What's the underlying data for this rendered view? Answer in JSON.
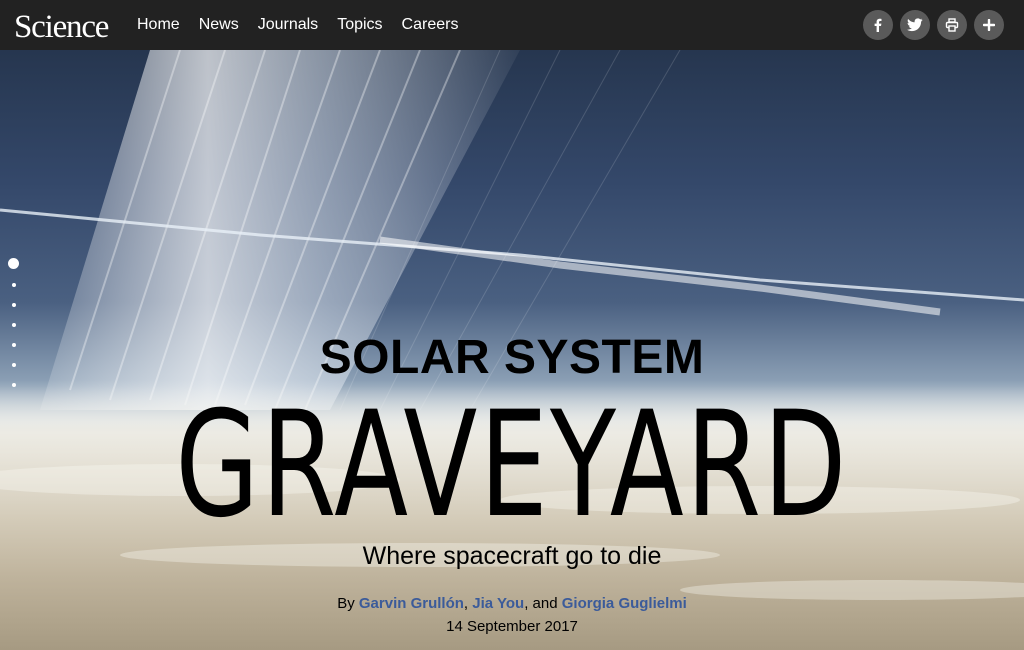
{
  "brand": {
    "logo_text": "Science"
  },
  "nav": {
    "items": [
      "Home",
      "News",
      "Journals",
      "Topics",
      "Careers"
    ]
  },
  "social": [
    {
      "name": "facebook-icon"
    },
    {
      "name": "twitter-icon"
    },
    {
      "name": "print-icon"
    },
    {
      "name": "plus-icon"
    }
  ],
  "article": {
    "kicker": "SOLAR SYSTEM",
    "title": "GRAVEYARD",
    "subtitle": "Where spacecraft go to die",
    "byline_prefix": "By",
    "authors": [
      "Garvin Grullón",
      "Jia You",
      "Giorgia Guglielmi"
    ],
    "author_sep_1": ",",
    "author_sep_2": ", and",
    "date": "14 September 2017"
  },
  "progress": {
    "total": 7,
    "current": 1
  },
  "colors": {
    "topbar": "#222222",
    "author_link": "#3b5b9a",
    "social_button": "#5a5a5a"
  }
}
